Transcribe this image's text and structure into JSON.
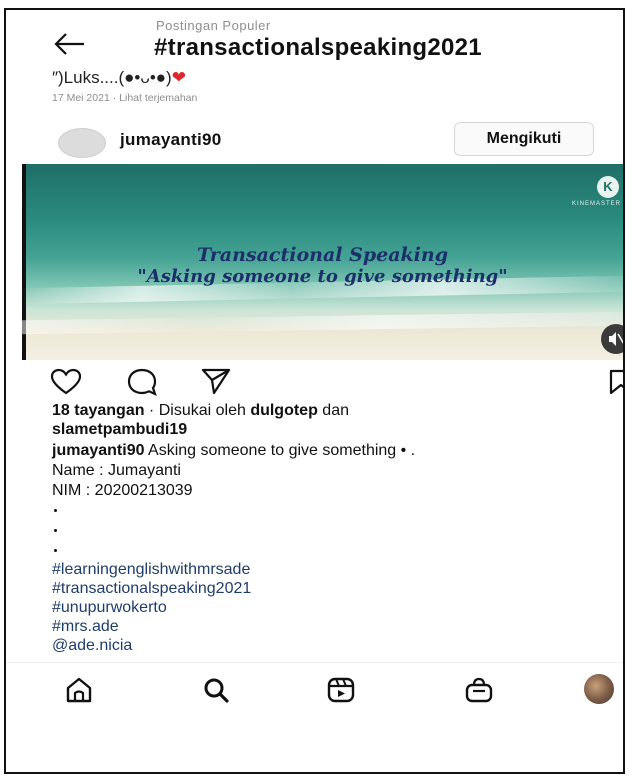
{
  "header": {
    "back_icon": "arrow-left-icon",
    "subtitle": "Postingan Populer",
    "title": "#transactionalspeaking2021"
  },
  "previous_post": {
    "caption": "″)Luks....(●•ᴗ•●)",
    "caption_icon": "red-heart-emoji",
    "date": "17 Mei 2021",
    "separator": "·",
    "translate_link": "Lihat terjemahan"
  },
  "post": {
    "username": "jumayanti90",
    "follow_label": "Mengikuti",
    "video": {
      "line1": "Transactional Speaking",
      "line2": "\"Asking someone to give something\"",
      "watermark": "KINEMASTER",
      "mute_icon": "speaker-muted-icon"
    },
    "actions": {
      "like_icon": "heart-outline-icon",
      "comment_icon": "comment-bubble-icon",
      "share_icon": "paper-plane-icon",
      "save_icon": "bookmark-icon"
    },
    "stats": {
      "views": "18 tayangan",
      "sep": " · ",
      "liked_by_prefix": "Disukai oleh ",
      "liked_user1": "dulgotep",
      "and": " dan",
      "liked_user2": "slametpambudi19"
    },
    "caption": {
      "author": "jumayanti90",
      "text": " Asking someone to give something • .",
      "name_line": "Name : Jumayanti",
      "nim_line": "NIM : 20200213039",
      "hashtags": [
        "#learningenglishwithmrsade",
        "#transactionalspeaking2021",
        "#unupurwokerto",
        "#mrs.ade",
        "@ade.nicia"
      ]
    }
  },
  "bottom_nav": {
    "items": [
      "home-icon",
      "search-icon",
      "reels-icon",
      "shop-icon",
      "profile-avatar"
    ]
  },
  "colors": {
    "heart": "#e0242c",
    "hashtag": "#1f3d6a",
    "video_text": "#1c2f6b"
  }
}
